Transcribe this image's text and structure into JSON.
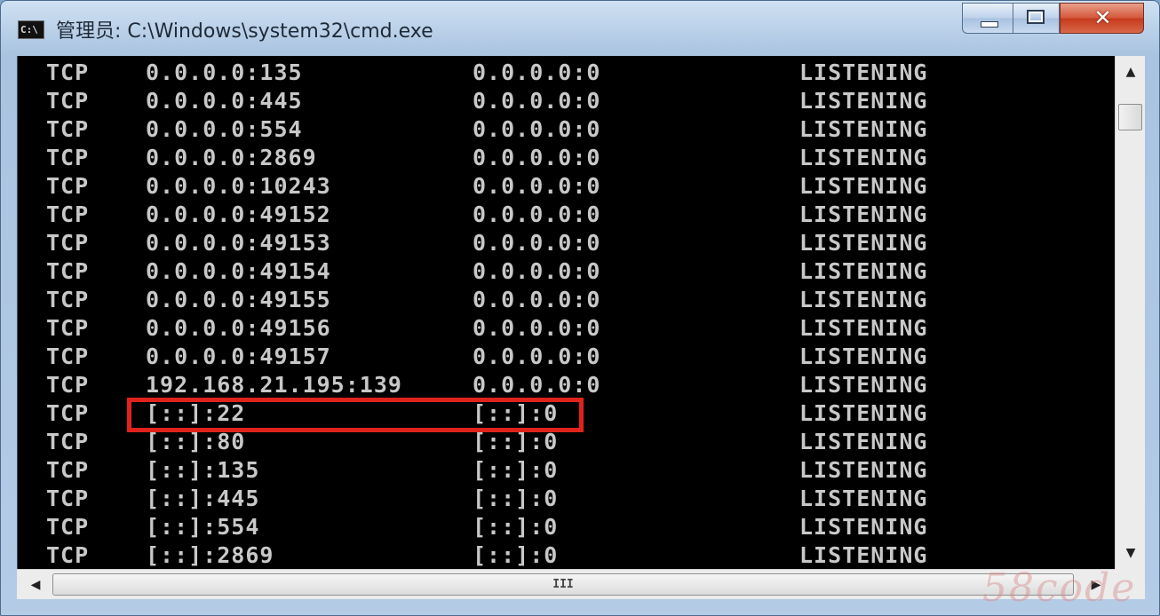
{
  "window": {
    "title": "管理员: C:\\Windows\\system32\\cmd.exe",
    "app_icon_text": "C:\\",
    "controls": {
      "minimize": "minimize",
      "maximize": "maximize",
      "close": "✕"
    }
  },
  "console": {
    "rows": [
      {
        "proto": "TCP",
        "local": "0.0.0.0:135",
        "foreign": "0.0.0.0:0",
        "state": "LISTENING"
      },
      {
        "proto": "TCP",
        "local": "0.0.0.0:445",
        "foreign": "0.0.0.0:0",
        "state": "LISTENING"
      },
      {
        "proto": "TCP",
        "local": "0.0.0.0:554",
        "foreign": "0.0.0.0:0",
        "state": "LISTENING"
      },
      {
        "proto": "TCP",
        "local": "0.0.0.0:2869",
        "foreign": "0.0.0.0:0",
        "state": "LISTENING"
      },
      {
        "proto": "TCP",
        "local": "0.0.0.0:10243",
        "foreign": "0.0.0.0:0",
        "state": "LISTENING"
      },
      {
        "proto": "TCP",
        "local": "0.0.0.0:49152",
        "foreign": "0.0.0.0:0",
        "state": "LISTENING"
      },
      {
        "proto": "TCP",
        "local": "0.0.0.0:49153",
        "foreign": "0.0.0.0:0",
        "state": "LISTENING"
      },
      {
        "proto": "TCP",
        "local": "0.0.0.0:49154",
        "foreign": "0.0.0.0:0",
        "state": "LISTENING"
      },
      {
        "proto": "TCP",
        "local": "0.0.0.0:49155",
        "foreign": "0.0.0.0:0",
        "state": "LISTENING"
      },
      {
        "proto": "TCP",
        "local": "0.0.0.0:49156",
        "foreign": "0.0.0.0:0",
        "state": "LISTENING"
      },
      {
        "proto": "TCP",
        "local": "0.0.0.0:49157",
        "foreign": "0.0.0.0:0",
        "state": "LISTENING"
      },
      {
        "proto": "TCP",
        "local": "192.168.21.195:139",
        "foreign": "0.0.0.0:0",
        "state": "LISTENING"
      },
      {
        "proto": "TCP",
        "local": "[::]:22",
        "foreign": "[::]:0",
        "state": "LISTENING"
      },
      {
        "proto": "TCP",
        "local": "[::]:80",
        "foreign": "[::]:0",
        "state": "LISTENING"
      },
      {
        "proto": "TCP",
        "local": "[::]:135",
        "foreign": "[::]:0",
        "state": "LISTENING"
      },
      {
        "proto": "TCP",
        "local": "[::]:445",
        "foreign": "[::]:0",
        "state": "LISTENING"
      },
      {
        "proto": "TCP",
        "local": "[::]:554",
        "foreign": "[::]:0",
        "state": "LISTENING"
      },
      {
        "proto": "TCP",
        "local": "[::]:2869",
        "foreign": "[::]:0",
        "state": "LISTENING"
      }
    ],
    "highlighted_row_index": 12,
    "highlight_color": "#e0221c",
    "text_color": "#c8c8c8",
    "background_color": "#000000"
  },
  "scrollbars": {
    "up_arrow": "▲",
    "down_arrow": "▼",
    "left_arrow": "◀",
    "right_arrow": "▶",
    "h_thumb_grip": "III"
  },
  "watermark": "58code"
}
